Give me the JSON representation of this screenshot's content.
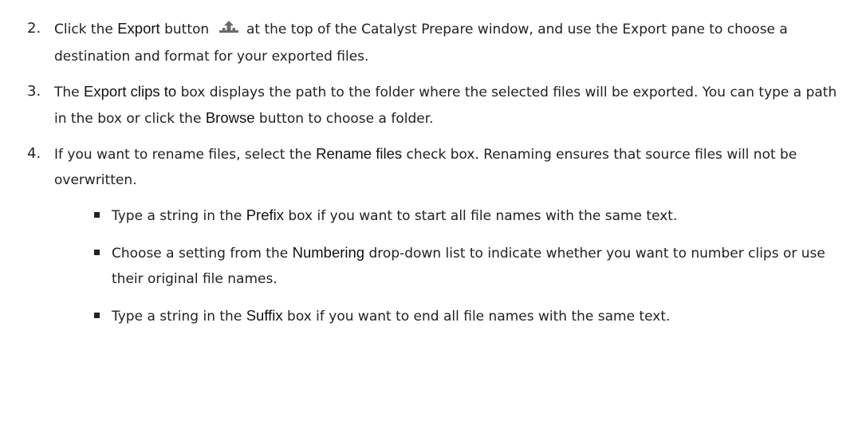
{
  "steps": [
    {
      "number": "2.",
      "t1": "Click the ",
      "b1": "Export",
      "t2": " button ",
      "icon": "export-upload-icon",
      "t3": " at the top of the Catalyst Prepare window, and use the Export pane to choose a destination and format for your exported files."
    },
    {
      "number": "3.",
      "t1": "The ",
      "b1": "Export clips to",
      "t2": " box displays the path to the folder where the selected files will be exported. You can type a path in the box or click the ",
      "b2": "Browse",
      "t3": " button to choose a folder."
    },
    {
      "number": "4.",
      "t1": "If you want to rename files, select the ",
      "b1": "Rename files",
      "t2": " check box. Renaming ensures that source files will not be overwritten."
    }
  ],
  "bullets": [
    {
      "t1": "Type a string in the ",
      "b1": "Prefix",
      "t2": " box if you want to start all file names with the same text."
    },
    {
      "t1": "Choose a setting from the ",
      "b1": "Numbering",
      "t2": " drop-down list to indicate whether you want to number clips or use their original file names."
    },
    {
      "t1": "Type a string in the ",
      "b1": "Suffix",
      "t2": " box if you want to end all file names with the same text."
    }
  ],
  "colors": {
    "text": "#222222",
    "icon": "#6a6a6a"
  }
}
